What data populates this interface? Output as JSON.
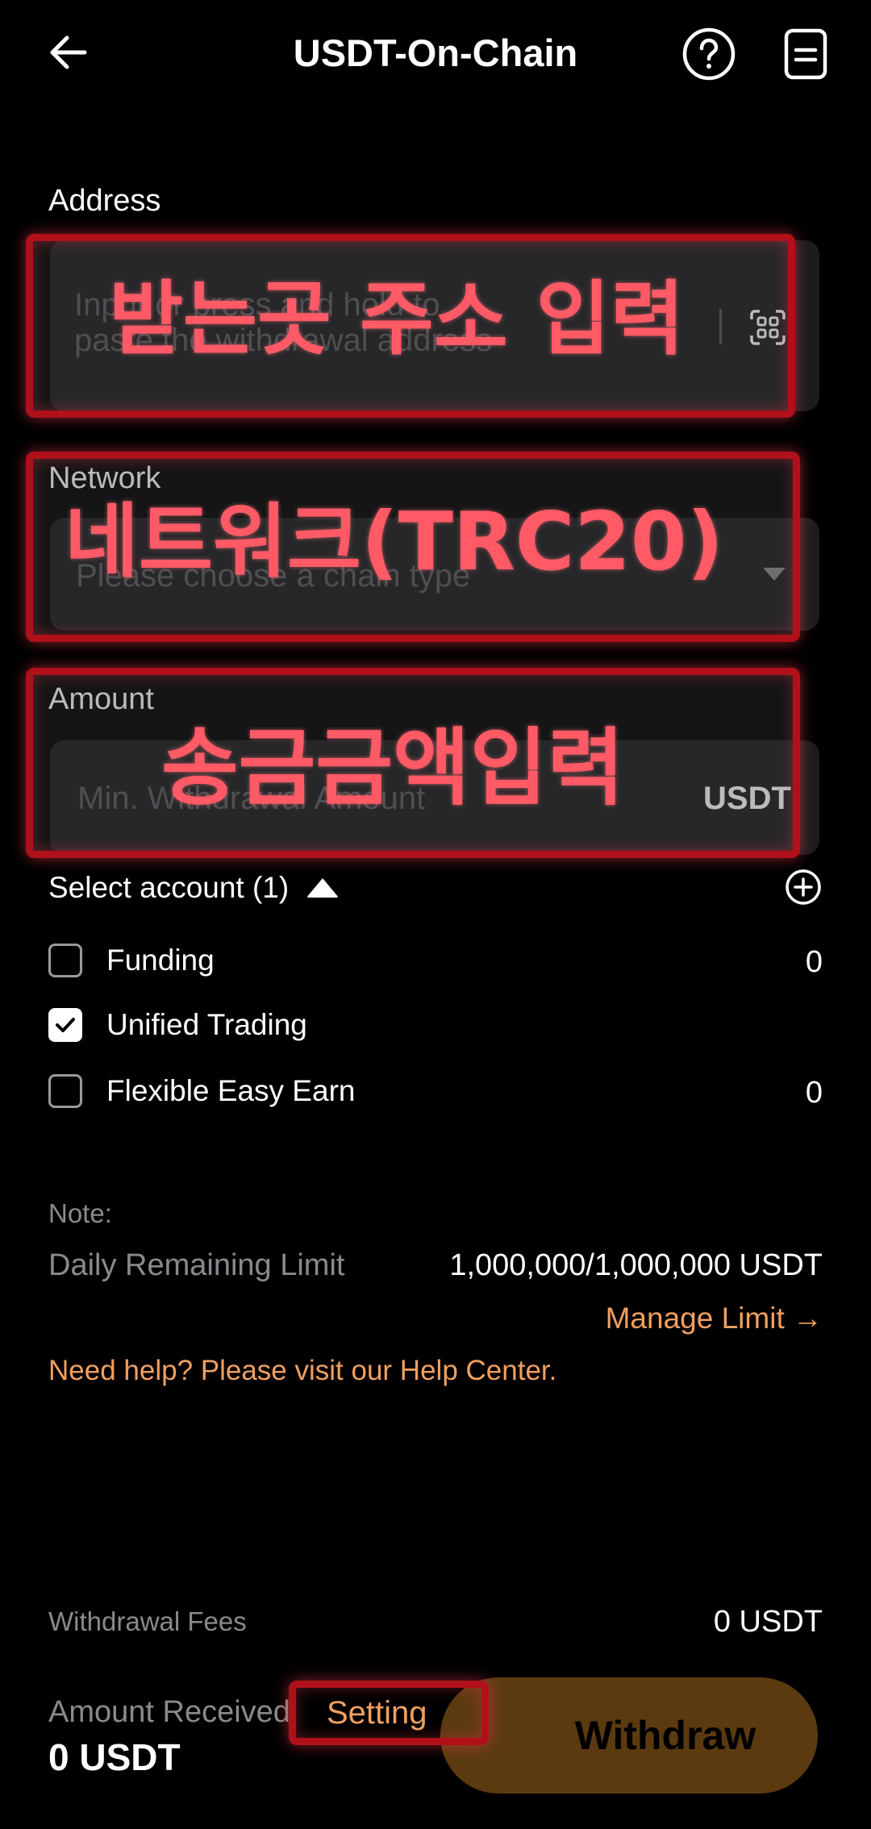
{
  "header": {
    "title": "USDT-On-Chain",
    "back_icon": "back-arrow-icon",
    "help_icon": "question-circle-icon",
    "records_icon": "document-icon"
  },
  "address": {
    "label": "Address",
    "placeholder_line1": "Input or press and hold to",
    "placeholder_line2": "paste the withdrawal address",
    "scan_icon": "qr-scan-icon",
    "overlay_text": "받는곳 주소 입력"
  },
  "network": {
    "label": "Network",
    "placeholder": "Please choose a chain type",
    "overlay_text": "네트워크(TRC20)"
  },
  "amount": {
    "label": "Amount",
    "placeholder": "Min. Withdrawal Amount",
    "unit": "USDT",
    "overlay_text": "송금금액입력"
  },
  "accounts": {
    "header": "Select account (1)",
    "items": [
      {
        "label": "Funding",
        "value": "0",
        "checked": false
      },
      {
        "label": "Unified Trading",
        "value": "",
        "checked": true
      },
      {
        "label": "Flexible Easy Earn",
        "value": "0",
        "checked": false
      }
    ]
  },
  "note": {
    "label": "Note:",
    "limit_label": "Daily Remaining Limit",
    "limit_value": "1,000,000/1,000,000 USDT",
    "manage_link": "Manage Limit →",
    "help_link": "Need help? Please visit our Help Center."
  },
  "footer": {
    "fees_label": "Withdrawal Fees",
    "fees_value": "0 USDT",
    "received_label": "Amount Received",
    "received_value": "0 USDT",
    "setting_label": "Setting",
    "withdraw_label": "Withdraw"
  },
  "colors": {
    "accent": "#f0a060",
    "withdraw_bg": "#5c3a10",
    "overlay_red": "#b0101a",
    "overlay_text": "#ff5a66"
  }
}
